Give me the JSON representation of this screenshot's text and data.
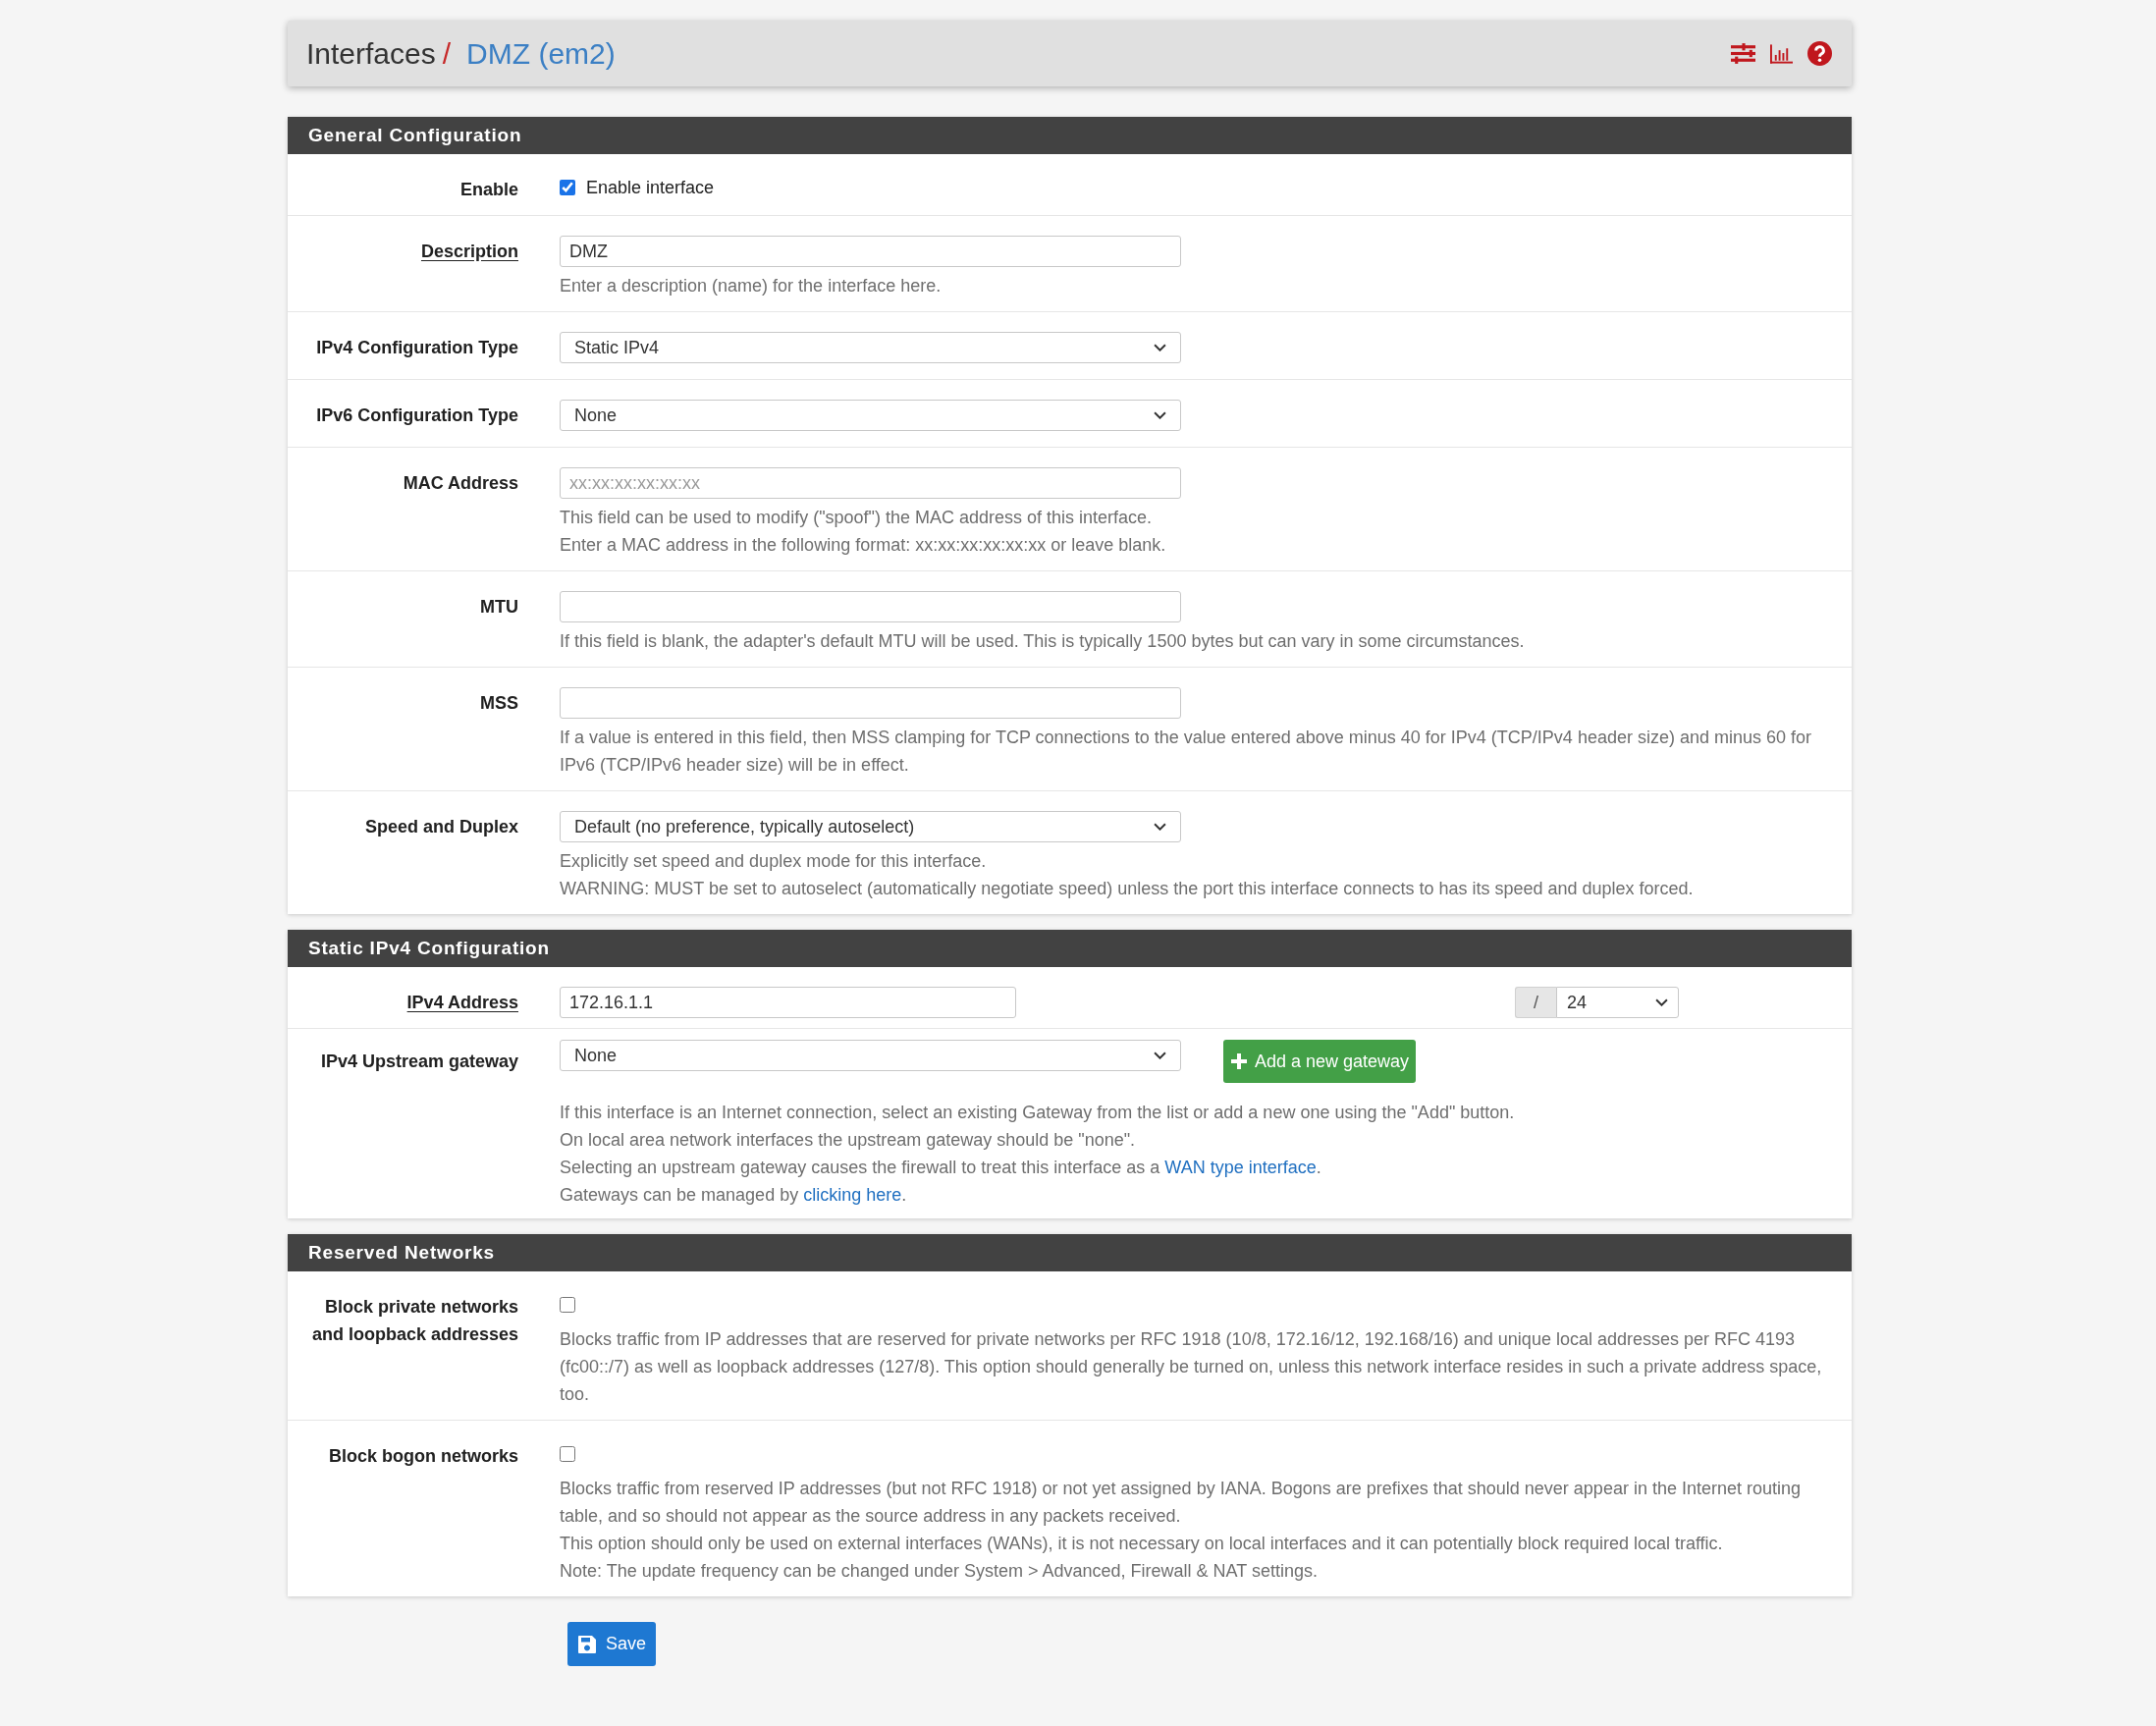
{
  "header": {
    "breadcrumbs": [
      {
        "label": "Interfaces",
        "current": false
      },
      {
        "label": "DMZ (em2)",
        "current": true
      }
    ],
    "separator": "/"
  },
  "sections": [
    {
      "title": "General Configuration",
      "rows": [
        {
          "label": "Enable",
          "required": false,
          "kind": "checkbox",
          "checked": true,
          "option": "Enable interface"
        },
        {
          "label": "Description",
          "required": true,
          "kind": "text",
          "value": "DMZ",
          "help": [
            "Enter a description (name) for the interface here."
          ]
        },
        {
          "label": "IPv4 Configuration Type",
          "required": false,
          "kind": "select",
          "value": "Static IPv4"
        },
        {
          "label": "IPv6 Configuration Type",
          "required": false,
          "kind": "select",
          "value": "None"
        },
        {
          "label": "MAC Address",
          "required": false,
          "kind": "text",
          "placeholder": "xx:xx:xx:xx:xx:xx",
          "help": [
            "This field can be used to modify (\"spoof\") the MAC address of this interface.",
            "Enter a MAC address in the following format: xx:xx:xx:xx:xx:xx or leave blank."
          ]
        },
        {
          "label": "MTU",
          "required": false,
          "kind": "text",
          "help": [
            "If this field is blank, the adapter's default MTU will be used. This is typically 1500 bytes but can vary in some circumstances."
          ]
        },
        {
          "label": "MSS",
          "required": false,
          "kind": "text",
          "help": [
            "If a value is entered in this field, then MSS clamping for TCP connections to the value entered above minus 40 for IPv4 (TCP/IPv4 header size) and minus 60 for IPv6 (TCP/IPv6 header size) will be in effect."
          ]
        },
        {
          "label": "Speed and Duplex",
          "required": false,
          "kind": "select",
          "value": "Default (no preference, typically autoselect)",
          "help": [
            "Explicitly set speed and duplex mode for this interface.",
            "WARNING: MUST be set to autoselect (automatically negotiate speed) unless the port this interface connects to has its speed and duplex forced."
          ]
        }
      ]
    },
    {
      "title": "Static IPv4 Configuration",
      "rows": [
        {
          "label": "IPv4 Address",
          "required": true,
          "kind": "address",
          "value": "172.16.1.1",
          "separator": "/",
          "mask": "24"
        },
        {
          "label": "IPv4 Upstream gateway",
          "required": false,
          "kind": "gateway",
          "value": "None",
          "button": "Add a new gateway",
          "help": [
            "If this interface is an Internet connection, select an existing Gateway from the list or add a new one using the \"Add\" button.",
            "On local area network interfaces the upstream gateway should be \"none\".",
            {
              "text": "Selecting an upstream gateway causes the firewall to treat this interface as a ",
              "link": "WAN type interface",
              "after": "."
            },
            {
              "text": "Gateways can be managed by ",
              "link": "clicking here",
              "after": "."
            }
          ]
        }
      ]
    },
    {
      "title": "Reserved Networks",
      "rows": [
        {
          "label": "Block private networks and loopback addresses",
          "required": false,
          "kind": "checkbox",
          "checked": false,
          "help": [
            "Blocks traffic from IP addresses that are reserved for private networks per RFC 1918 (10/8, 172.16/12, 192.168/16) and unique local addresses per RFC 4193 (fc00::/7) as well as loopback addresses (127/8). This option should generally be turned on, unless this network interface resides in such a private address space, too."
          ]
        },
        {
          "label": "Block bogon networks",
          "required": false,
          "kind": "checkbox",
          "checked": false,
          "help": [
            "Blocks traffic from reserved IP addresses (but not RFC 1918) or not yet assigned by IANA. Bogons are prefixes that should never appear in the Internet routing table, and so should not appear as the source address in any packets received.",
            "This option should only be used on external interfaces (WANs), it is not necessary on local interfaces and it can potentially block required local traffic.",
            "Note: The update frequency can be changed under System > Advanced, Firewall & NAT settings."
          ]
        }
      ]
    }
  ],
  "save_button": "Save"
}
